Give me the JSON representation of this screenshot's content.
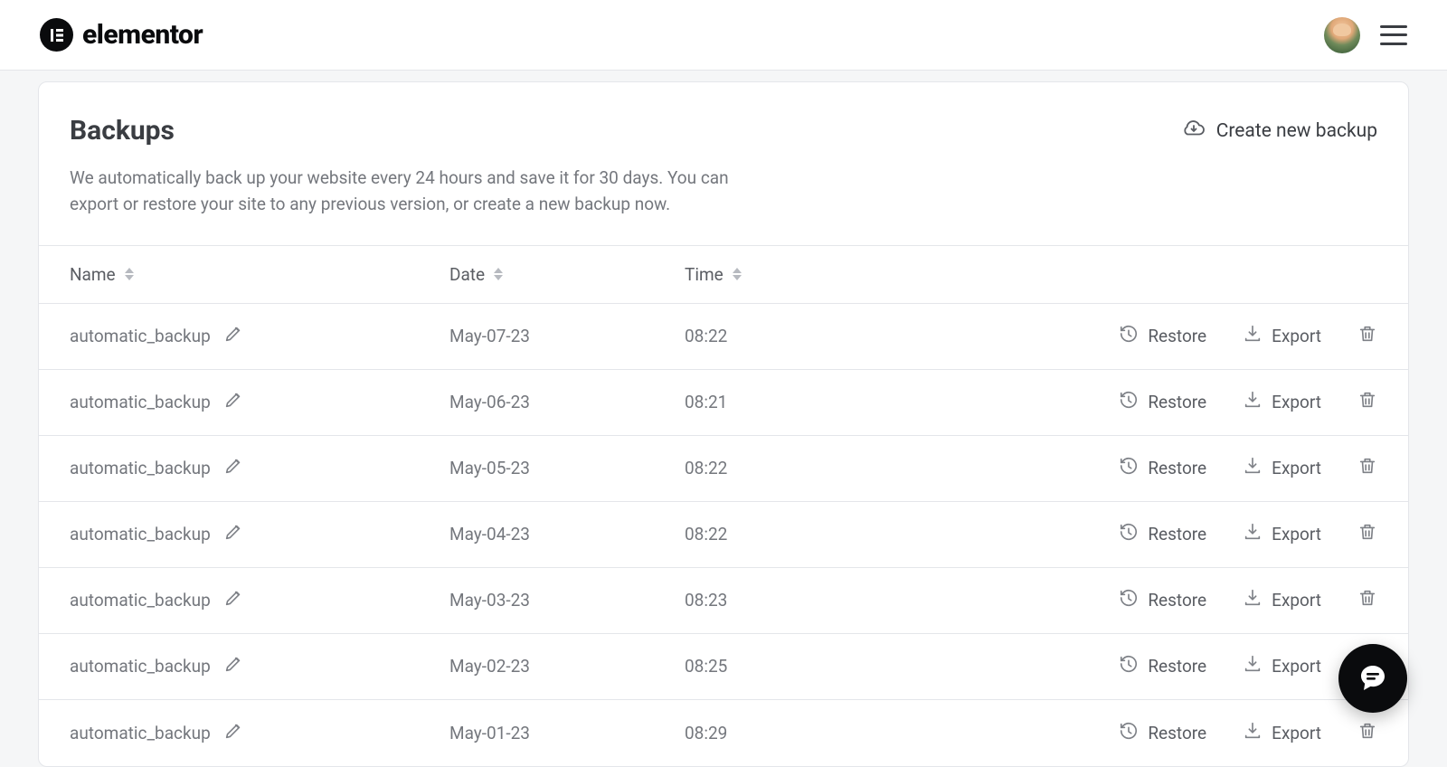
{
  "header": {
    "brand": "elementor"
  },
  "page": {
    "title": "Backups",
    "description": "We automatically back up your website every 24 hours and save it for 30 days. You can export or restore your site to any previous version, or create a new backup now.",
    "create_label": "Create new backup"
  },
  "columns": {
    "name": "Name",
    "date": "Date",
    "time": "Time"
  },
  "actions": {
    "restore": "Restore",
    "export": "Export"
  },
  "backups": [
    {
      "name": "automatic_backup",
      "date": "May-07-23",
      "time": "08:22"
    },
    {
      "name": "automatic_backup",
      "date": "May-06-23",
      "time": "08:21"
    },
    {
      "name": "automatic_backup",
      "date": "May-05-23",
      "time": "08:22"
    },
    {
      "name": "automatic_backup",
      "date": "May-04-23",
      "time": "08:22"
    },
    {
      "name": "automatic_backup",
      "date": "May-03-23",
      "time": "08:23"
    },
    {
      "name": "automatic_backup",
      "date": "May-02-23",
      "time": "08:25"
    },
    {
      "name": "automatic_backup",
      "date": "May-01-23",
      "time": "08:29"
    }
  ]
}
